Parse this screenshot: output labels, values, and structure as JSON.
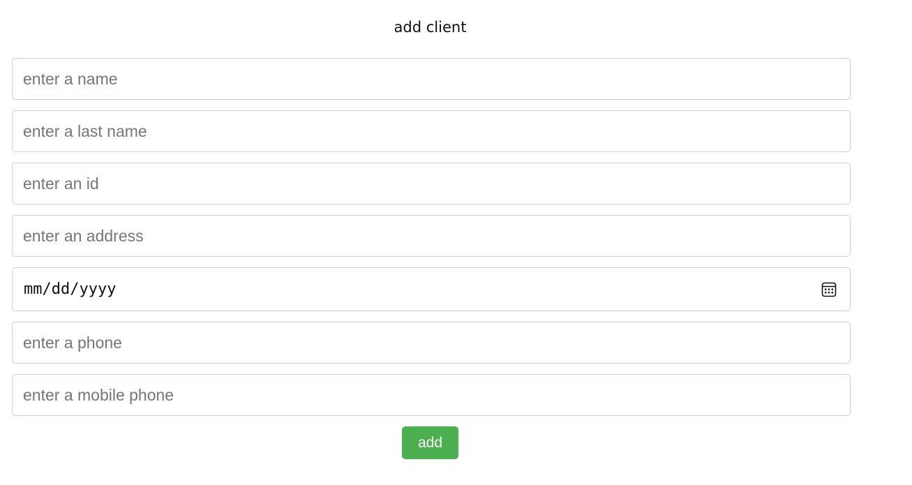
{
  "page": {
    "title": "add client"
  },
  "form": {
    "fields": [
      {
        "placeholder": "enter a name",
        "value": ""
      },
      {
        "placeholder": "enter a last name",
        "value": ""
      },
      {
        "placeholder": "enter an id",
        "value": ""
      },
      {
        "placeholder": "enter an address",
        "value": ""
      },
      {
        "placeholder": "mm/dd/yyyy",
        "value": "",
        "icon": "calendar-icon"
      },
      {
        "placeholder": "enter a phone",
        "value": ""
      },
      {
        "placeholder": "enter a mobile phone",
        "value": ""
      }
    ],
    "submit_label": "add"
  },
  "colors": {
    "submit_background": "#4caf50",
    "submit_text": "#ffffff",
    "field_border": "#cfcfcf",
    "placeholder_text": "#767676"
  }
}
